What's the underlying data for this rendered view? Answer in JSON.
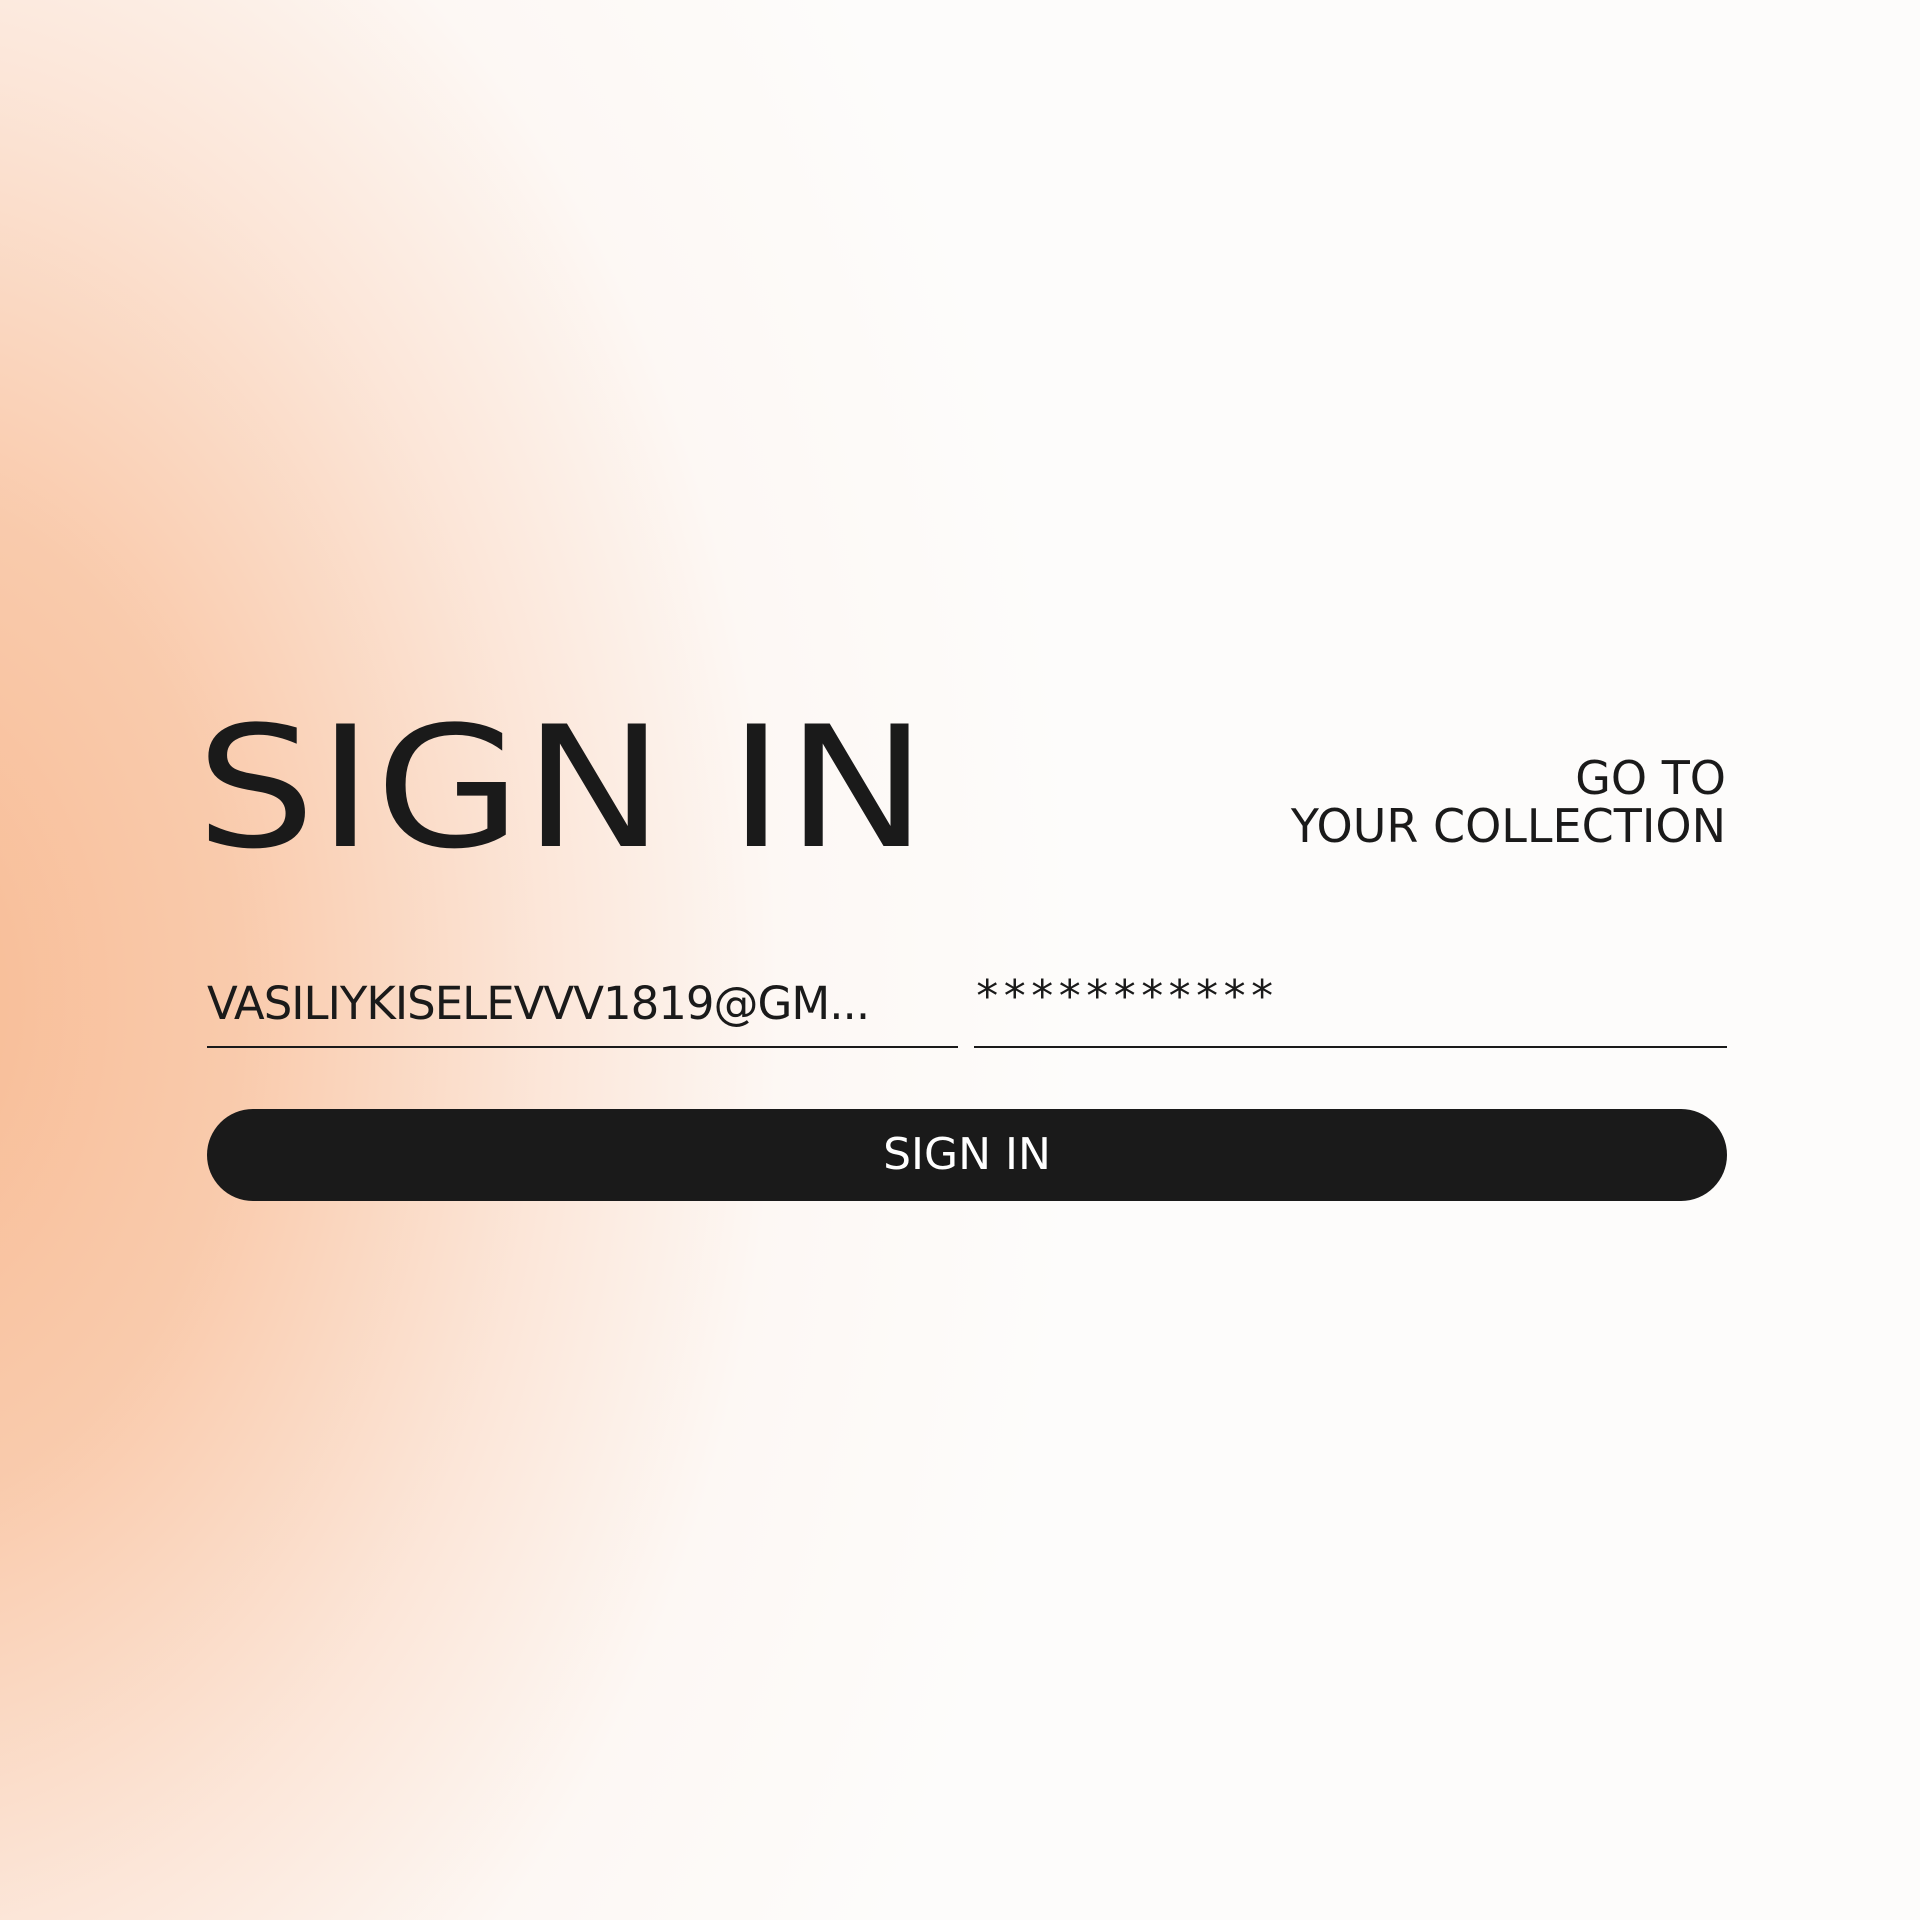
{
  "header": {
    "title": "SIGN IN",
    "link_line1": "GO TO",
    "link_line2": "YOUR COLLECTION"
  },
  "form": {
    "email_value": "VASILIYKISELEVVV1819@GM...",
    "password_value": "***********",
    "submit_label": "SIGN IN"
  },
  "colors": {
    "accent_gradient_start": "#f8ba92",
    "background": "#fdfcfb",
    "text": "#1a1a1a",
    "button_bg": "#1a1a1a",
    "button_text": "#ffffff"
  }
}
